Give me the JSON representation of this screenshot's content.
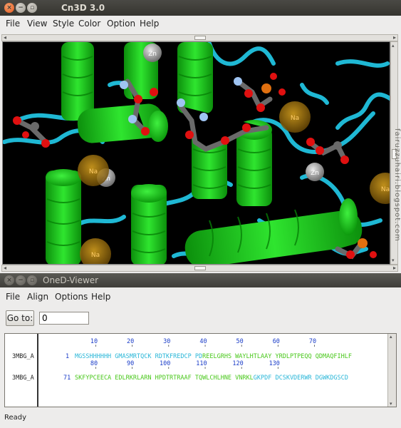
{
  "cn3d": {
    "title": "Cn3D 3.0",
    "menu": [
      "File",
      "View",
      "Style",
      "Color",
      "Option",
      "Help"
    ],
    "labels": {
      "zn": "Zn",
      "na": "Na"
    }
  },
  "watermark": "fairuzzuhairi.blogspot.com",
  "oned": {
    "title": "OneD-Viewer",
    "menu": [
      "File",
      "Align",
      "Options",
      "Help"
    ],
    "goto_label": "Go to:",
    "goto_value": "0",
    "rows": [
      {
        "name": "3MBG_A",
        "ruler": "       10        20        30        40        50        60        70",
        "ticks": "        '         '         '         '         '         '         '",
        "start": "1",
        "seq_cyan": "MGSSHHHHHH GMASMRTQCK RDTKFREDCP PD",
        "seq_green": "REELGRHS WAYLHTLAAY YRDLPTPEQQ QDMAQFIHLF"
      },
      {
        "name": "3MBG_A",
        "ruler": "       80        90       100       110       120       130",
        "ticks": "        '         '         '         '         '         '",
        "start": "71",
        "seq_green": "SKFYPCEECA EDLRKRLARN HPDTRTRAAF TQWLCHLHNE VNRKL",
        "seq_cyan": "GKPDF DCSKVDERWR DGWKDGSCD"
      }
    ],
    "status": "Ready"
  },
  "colors": {
    "helix": "#19d11a",
    "coil": "#1fb8d4",
    "ion_na": "#b8860b",
    "ion_zn": "#a8a8a8",
    "oxygen": "#e01010",
    "nitrogen": "#9fc4f2",
    "phosphorus": "#e07010",
    "carbon": "#6a6a6a"
  }
}
